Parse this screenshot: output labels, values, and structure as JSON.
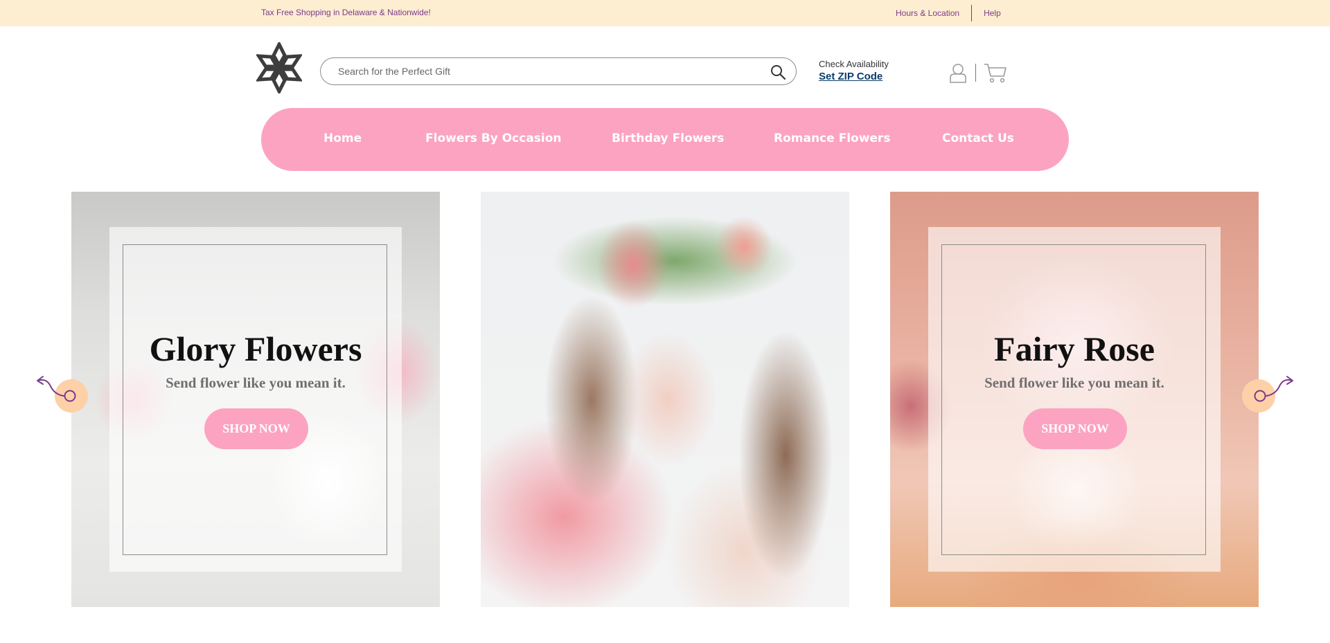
{
  "topbar": {
    "promo": "Tax Free Shopping in Delaware & Nationwide!",
    "hours_link": "Hours & Location",
    "help_link": "Help"
  },
  "search": {
    "placeholder": "Search for the Perfect Gift",
    "value": ""
  },
  "availability": {
    "label": "Check Availability",
    "link": "Set ZIP Code"
  },
  "nav": {
    "items": [
      {
        "label": "Home"
      },
      {
        "label": "Flowers By Occasion"
      },
      {
        "label": "Birthday Flowers"
      },
      {
        "label": "Romance Flowers"
      },
      {
        "label": "Contact Us"
      }
    ]
  },
  "carousel": {
    "slides": [
      {
        "title": "Glory Flowers",
        "tagline": "Send flower like you mean it.",
        "button": "SHOP NOW"
      },
      {
        "title": "",
        "tagline": "",
        "button": ""
      },
      {
        "title": "Fairy Rose",
        "tagline": "Send flower like you mean it.",
        "button": "SHOP NOW"
      }
    ]
  },
  "icons": [
    "logo-icon",
    "search-icon",
    "user-icon",
    "cart-icon",
    "arrow-left-icon",
    "arrow-right-icon"
  ],
  "colors": {
    "topbar_bg": "#fdeed2",
    "accent_pink": "#fca3c1",
    "link_purple": "#7a3a8a",
    "zip_link": "#0b3d6b",
    "arrow_circle": "#fdd0a8"
  }
}
